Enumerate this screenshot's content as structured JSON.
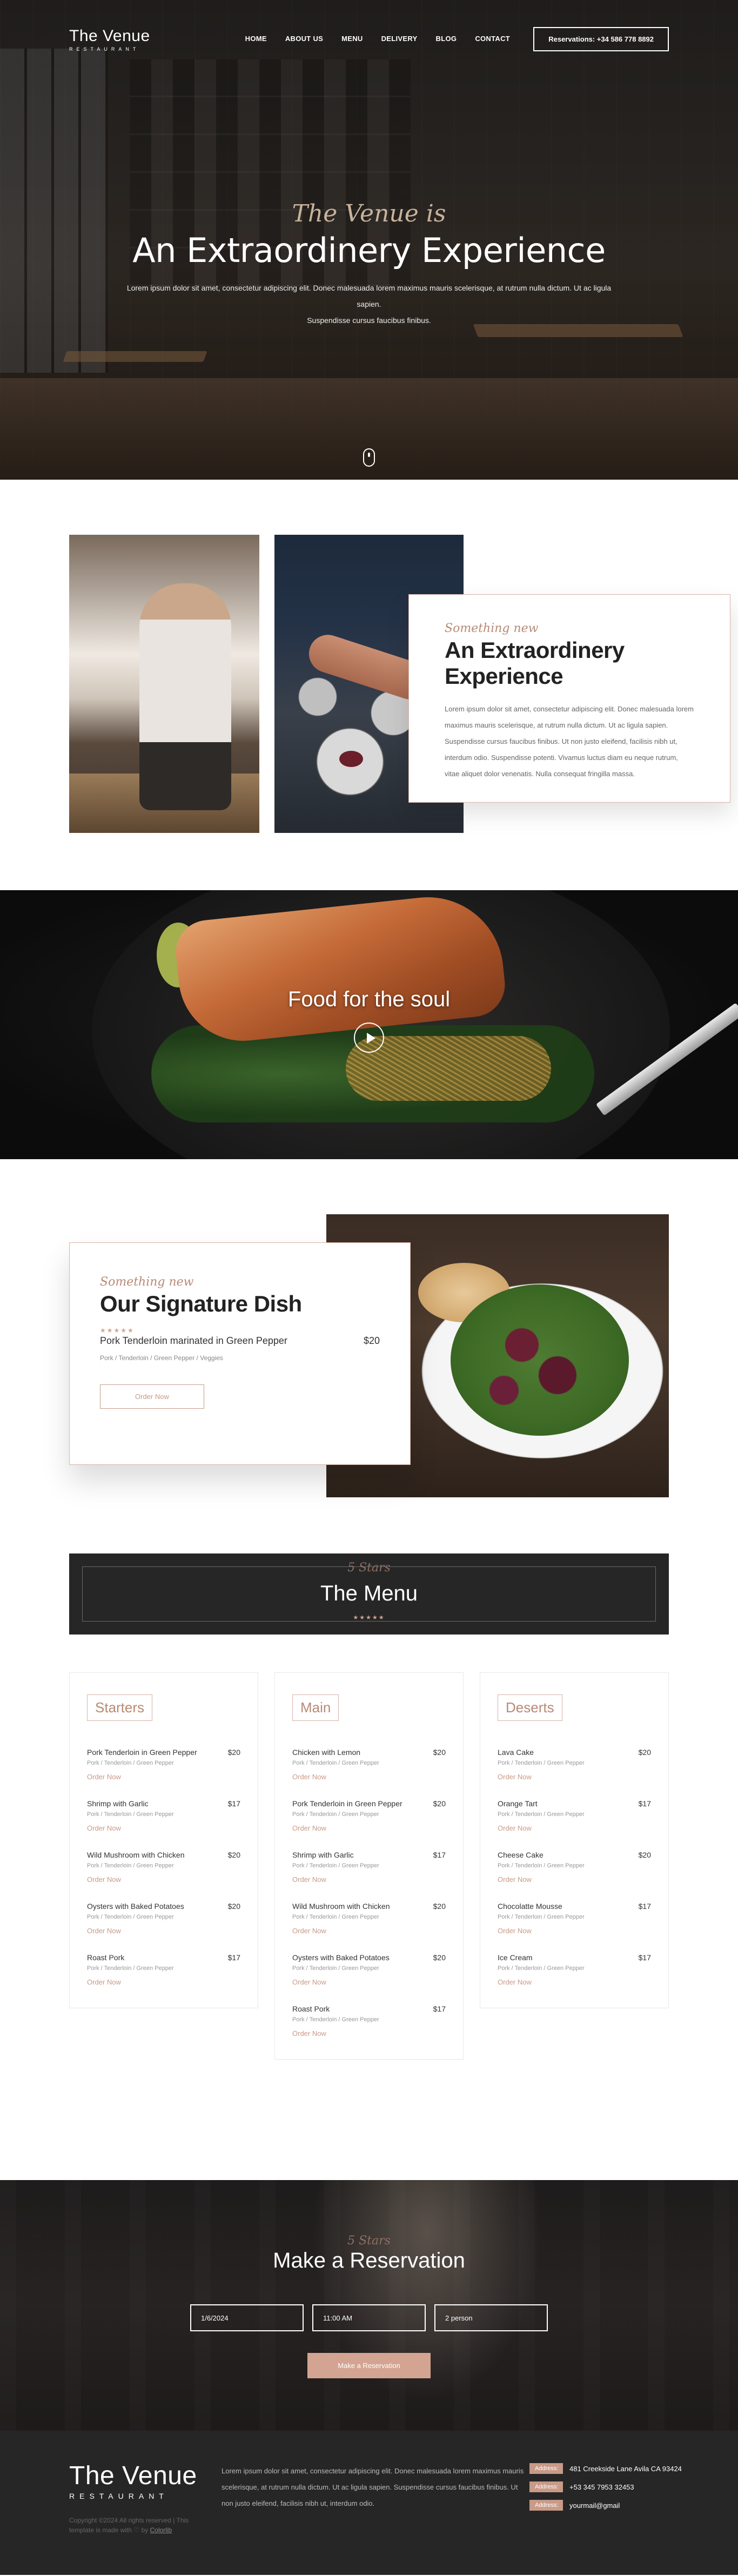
{
  "nav": {
    "logo_title": "The Venue",
    "logo_sub": "RESTAURANT",
    "items": [
      "HOME",
      "ABOUT US",
      "MENU",
      "DELIVERY",
      "BLOG",
      "CONTACT"
    ],
    "reservation": "Reservations: +34 586 778 8892"
  },
  "hero": {
    "script": "The Venue is",
    "title": "An Extraordinery Experience",
    "text_line1": "Lorem ipsum dolor sit amet, consectetur adipiscing elit. Donec malesuada lorem maximus mauris scelerisque, at rutrum nulla dictum. Ut ac ligula sapien.",
    "text_line2": "Suspendisse cursus faucibus finibus."
  },
  "about": {
    "script": "Something new",
    "title": "An Extraordinery Experience",
    "text": "Lorem ipsum dolor sit amet, consectetur adipiscing elit. Donec malesuada lorem maximus mauris scelerisque, at rutrum nulla dictum. Ut ac ligula sapien. Suspendisse cursus faucibus finibus. Ut non justo eleifend, facilisis nibh ut, interdum odio. Suspendisse potenti. Vivamus luctus diam eu neque rutrum, vitae aliquet dolor venenatis. Nulla consequat fringilla massa."
  },
  "banner": {
    "title": "Food for the soul"
  },
  "signature": {
    "script": "Something new",
    "title": "Our Signature Dish",
    "stars": "★★★★★",
    "dish": "Pork Tenderloin marinated in Green Pepper",
    "price": "$20",
    "ingredients": "Pork / Tenderloin / Green Pepper / Veggies",
    "order": "Order Now"
  },
  "menu": {
    "script": "5 Stars",
    "title": "The Menu",
    "stars": "★★★★★",
    "order_label": "Order Now",
    "columns": [
      {
        "category": "Starters",
        "items": [
          {
            "name": "Pork Tenderloin in Green Pepper",
            "price": "$20",
            "ingredients": "Pork / Tenderloin / Green Pepper"
          },
          {
            "name": "Shrimp with Garlic",
            "price": "$17",
            "ingredients": "Pork / Tenderloin / Green Pepper"
          },
          {
            "name": "Wild Mushroom with Chicken",
            "price": "$20",
            "ingredients": "Pork / Tenderloin / Green Pepper"
          },
          {
            "name": "Oysters with Baked Potatoes",
            "price": "$20",
            "ingredients": "Pork / Tenderloin / Green Pepper"
          },
          {
            "name": "Roast Pork",
            "price": "$17",
            "ingredients": "Pork / Tenderloin / Green Pepper"
          }
        ]
      },
      {
        "category": "Main",
        "items": [
          {
            "name": "Chicken with Lemon",
            "price": "$20",
            "ingredients": "Pork / Tenderloin / Green Pepper"
          },
          {
            "name": "Pork Tenderloin in Green Pepper",
            "price": "$20",
            "ingredients": "Pork / Tenderloin / Green Pepper"
          },
          {
            "name": "Shrimp with Garlic",
            "price": "$17",
            "ingredients": "Pork / Tenderloin / Green Pepper"
          },
          {
            "name": "Wild Mushroom with Chicken",
            "price": "$20",
            "ingredients": "Pork / Tenderloin / Green Pepper"
          },
          {
            "name": "Oysters with Baked Potatoes",
            "price": "$20",
            "ingredients": "Pork / Tenderloin / Green Pepper"
          },
          {
            "name": "Roast Pork",
            "price": "$17",
            "ingredients": "Pork / Tenderloin / Green Pepper"
          }
        ]
      },
      {
        "category": "Deserts",
        "items": [
          {
            "name": "Lava Cake",
            "price": "$20",
            "ingredients": "Pork / Tenderloin / Green Pepper"
          },
          {
            "name": "Orange Tart",
            "price": "$17",
            "ingredients": "Pork / Tenderloin / Green Pepper"
          },
          {
            "name": "Cheese Cake",
            "price": "$20",
            "ingredients": "Pork / Tenderloin / Green Pepper"
          },
          {
            "name": "Chocolatte Mousse",
            "price": "$17",
            "ingredients": "Pork / Tenderloin / Green Pepper"
          },
          {
            "name": "Ice Cream",
            "price": "$17",
            "ingredients": "Pork / Tenderloin / Green Pepper"
          }
        ]
      }
    ]
  },
  "reservation": {
    "script": "5 Stars",
    "title": "Make a Reservation",
    "date_value": "1/6/2024",
    "time_value": "11:00 AM",
    "people_value": "2 person",
    "submit": "Make a Reservation"
  },
  "footer": {
    "logo_title": "The Venue",
    "logo_sub": "RESTAURANT",
    "copyright": "Copyright ©2024 All rights reserved | This template is made with ♡ by",
    "credit": "Colorlib",
    "text": "Lorem ipsum dolor sit amet, consectetur adipiscing elit. Donec malesuada lorem maximus mauris scelerisque, at rutrum nulla dictum. Ut ac ligula sapien. Suspendisse cursus faucibus finibus. Ut non justo eleifend, facilisis nibh ut, interdum odio.",
    "contacts": [
      {
        "tag": "Address:",
        "value": "481 Creekside Lane Avila CA 93424"
      },
      {
        "tag": "Address:",
        "value": "+53 345 7953 32453"
      },
      {
        "tag": "Address:",
        "value": "yourmail@gmail"
      }
    ]
  },
  "colors": {
    "accent": "#d4a492",
    "dark": "#262626",
    "script": "#b98a75"
  }
}
